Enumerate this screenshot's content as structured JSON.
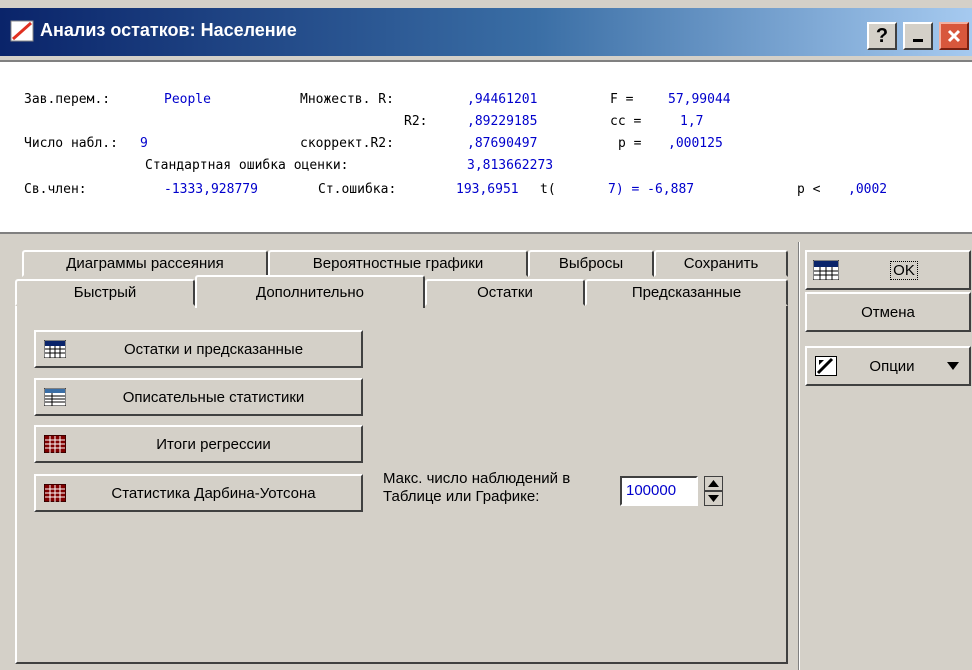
{
  "window": {
    "title": "Анализ остатков: Население",
    "help_label": "?"
  },
  "results": {
    "dep_var_label": "Зав.перем.:",
    "dep_var_value": "People",
    "multiple_r_label": "Множеств. R:",
    "multiple_r_value": ",94461201",
    "f_label": "F =",
    "f_value": "57,99044",
    "r2_label": "R2:",
    "r2_value": ",89229185",
    "df_label": "cc =",
    "df_value": "1,7",
    "n_label": "Число набл.:",
    "n_value": "9",
    "adj_r2_label": "скоррект.R2:",
    "adj_r2_value": ",87690497",
    "p_label": "p =",
    "p_value": ",000125",
    "se_label": "Стандартная ошибка оценки:",
    "se_value": "3,813662273",
    "intercept_label": "Св.член:",
    "intercept_value": "-1333,928779",
    "stderr_label": "Ст.ошибка:",
    "stderr_value": "193,6951",
    "t_label": "t(",
    "t_value": "7) = -6,887",
    "p2_label": "p <",
    "p2_value": ",0002"
  },
  "tabs_top": [
    "Диаграммы рассеяния",
    "Вероятностные графики",
    "Выбросы",
    "Сохранить"
  ],
  "tabs_bottom": [
    "Быстрый",
    "Дополнительно",
    "Остатки",
    "Предсказанные"
  ],
  "active_tab": "Дополнительно",
  "buttons": {
    "residuals": "Остатки и предсказанные",
    "descriptive": "Описательные статистики",
    "summary": "Итоги регрессии",
    "durbin": "Статистика Дарбина-Уотсона"
  },
  "max_obs": {
    "label": "Макс. число наблюдений в\nТаблице или Графике:",
    "value": "100000"
  },
  "side": {
    "ok": "OK",
    "cancel": "Отмена",
    "options": "Опции"
  },
  "colors": {
    "face": "#d4d0c8",
    "title_start": "#0a246a",
    "title_end": "#a6caf0",
    "value_blue": "#0000cc",
    "close_red": "#d8573c"
  }
}
